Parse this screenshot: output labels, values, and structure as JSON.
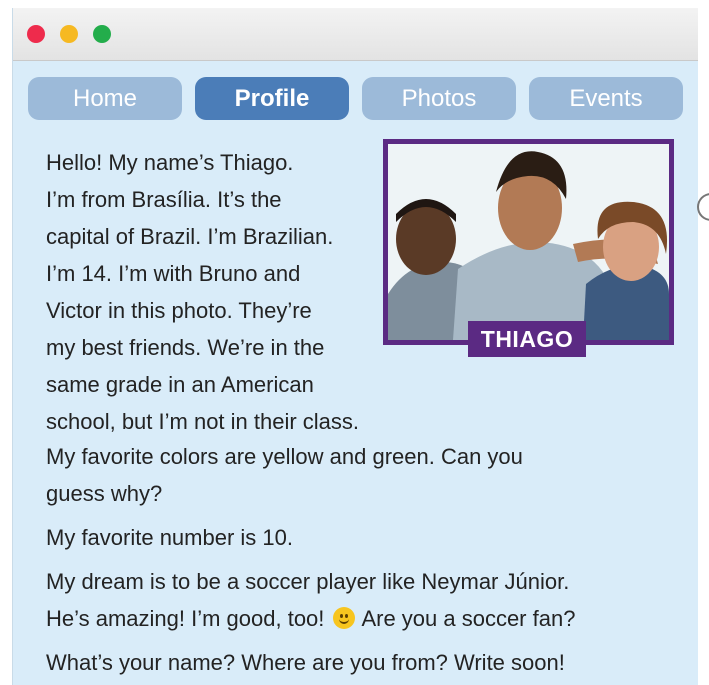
{
  "window": {
    "controls": [
      "close",
      "minimize",
      "maximize"
    ]
  },
  "nav": {
    "tabs": [
      {
        "label": "Home",
        "active": false
      },
      {
        "label": "Profile",
        "active": true
      },
      {
        "label": "Photos",
        "active": false
      },
      {
        "label": "Events",
        "active": false
      }
    ]
  },
  "profile": {
    "photo_label": "THIAGO",
    "intro_lines": [
      "Hello! My name’s Thiago.",
      "I’m from Brasília. It’s the",
      "capital of Brazil. I’m Brazilian.",
      "I’m 14. I’m with Bruno and",
      "Victor in this photo. They’re",
      "my best friends. We’re in the",
      "same grade in an American",
      "school, but I’m not in their class."
    ],
    "colors_line1": "My favorite colors are yellow and green. Can you",
    "colors_line2": "guess why?",
    "number": "My favorite number is 10.",
    "dream_line1": "My dream is to be a soccer player like Neymar Júnior.",
    "dream_line2_before": "He’s amazing! I’m good, too!",
    "dream_line2_after": "Are you a soccer fan?",
    "closing": "What’s your name? Where are you from? Write soon!"
  },
  "icons": {
    "emoji": "smiley-face-icon"
  },
  "colors": {
    "tab_active": "#4b7db8",
    "tab_inactive": "#9cbad9",
    "frame": "#5b2a83",
    "page_bg": "#d9ecf9"
  }
}
